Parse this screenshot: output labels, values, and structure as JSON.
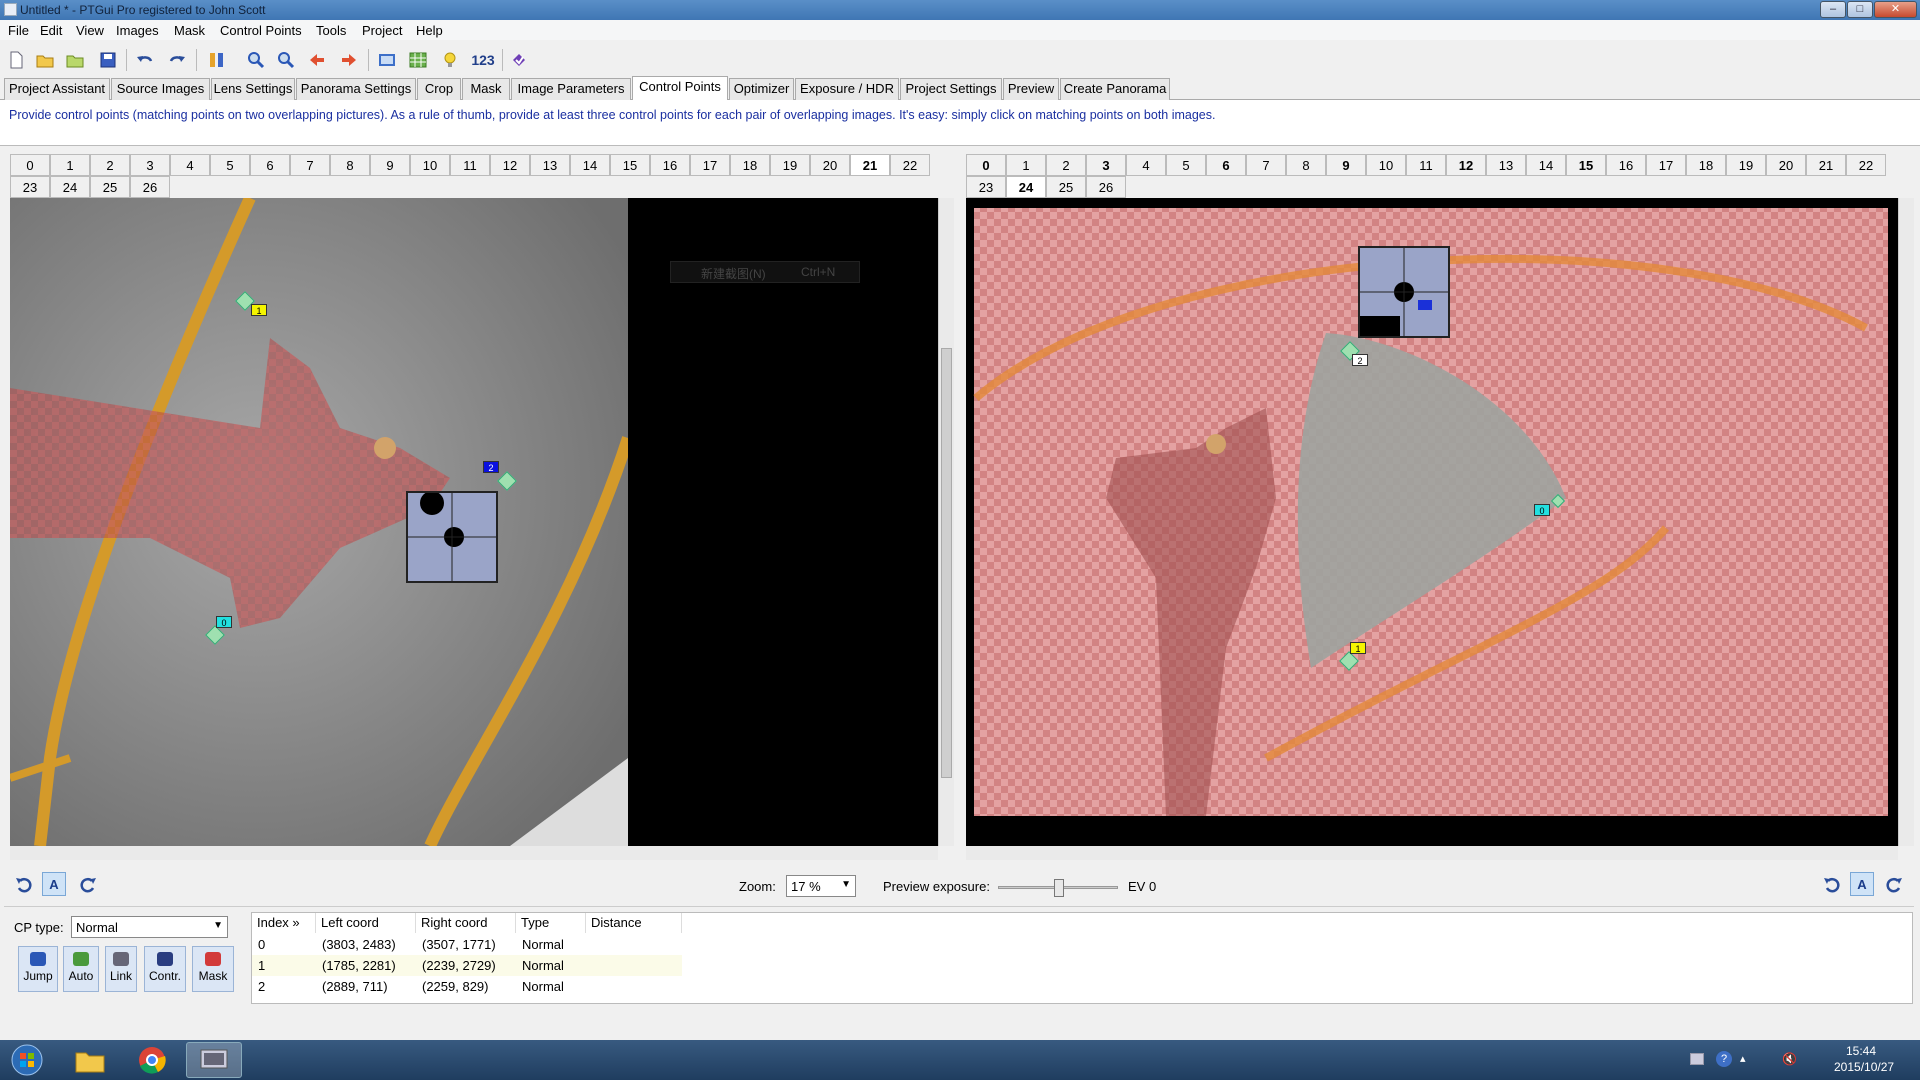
{
  "window": {
    "title": "Untitled * - PTGui Pro registered to John Scott",
    "min": "–",
    "max": "□",
    "close": "✕"
  },
  "menu": [
    "File",
    "Edit",
    "View",
    "Images",
    "Mask",
    "Control Points",
    "Tools",
    "Project",
    "Help"
  ],
  "toolbar": {
    "number_label": "123"
  },
  "tabs": [
    "Project Assistant",
    "Source Images",
    "Lens Settings",
    "Panorama Settings",
    "Crop",
    "Mask",
    "Image Parameters",
    "Control Points",
    "Optimizer",
    "Exposure / HDR",
    "Project Settings",
    "Preview",
    "Create Panorama"
  ],
  "active_tab": "Control Points",
  "hint": "Provide control points (matching points on two overlapping pictures). As a rule of thumb, provide at least three control points for each pair of overlapping images. It's easy: simply click on matching points on both images.",
  "left_images": [
    "0",
    "1",
    "2",
    "3",
    "4",
    "5",
    "6",
    "7",
    "8",
    "9",
    "10",
    "11",
    "12",
    "13",
    "14",
    "15",
    "16",
    "17",
    "18",
    "19",
    "20",
    "21",
    "22",
    "23",
    "24",
    "25",
    "26"
  ],
  "left_selected": "21",
  "right_images": [
    "0",
    "1",
    "2",
    "3",
    "4",
    "5",
    "6",
    "7",
    "8",
    "9",
    "10",
    "11",
    "12",
    "13",
    "14",
    "15",
    "16",
    "17",
    "18",
    "19",
    "20",
    "21",
    "22",
    "23",
    "24",
    "25",
    "26"
  ],
  "right_selected": "24",
  "right_bold": [
    "0",
    "3",
    "6",
    "9",
    "12",
    "15"
  ],
  "context_menu": {
    "label": "新建截图(N)",
    "shortcut": "Ctrl+N"
  },
  "left_points": [
    {
      "label": "1",
      "color": "#f5f500"
    },
    {
      "label": "2",
      "color": "#0a10e0"
    },
    {
      "label": "0",
      "color": "#22e0e0"
    }
  ],
  "right_points": [
    {
      "label": "2",
      "color": "#ffffff"
    },
    {
      "label": "1",
      "color": "#f5f500"
    },
    {
      "label": "0",
      "color": "#22e0e0"
    }
  ],
  "zoom": {
    "label": "Zoom:",
    "value": "17 %"
  },
  "exposure": {
    "label": "Preview exposure:",
    "ev": "EV 0",
    "slider_fraction": 0.5
  },
  "cp_type": {
    "label": "CP type:",
    "value": "Normal"
  },
  "actions": [
    "Jump",
    "Auto",
    "Link",
    "Contr.",
    "Mask"
  ],
  "table": {
    "headers": [
      "Index »",
      "Left coord",
      "Right coord",
      "Type",
      "Distance"
    ],
    "rows": [
      [
        "0",
        "(3803, 2483)",
        "(3507, 1771)",
        "Normal",
        ""
      ],
      [
        "1",
        "(1785, 2281)",
        "(2239, 2729)",
        "Normal",
        ""
      ],
      [
        "2",
        "(2889, 711)",
        "(2259, 829)",
        "Normal",
        ""
      ]
    ]
  },
  "clock": {
    "time": "15:44",
    "date": "2015/10/27"
  }
}
